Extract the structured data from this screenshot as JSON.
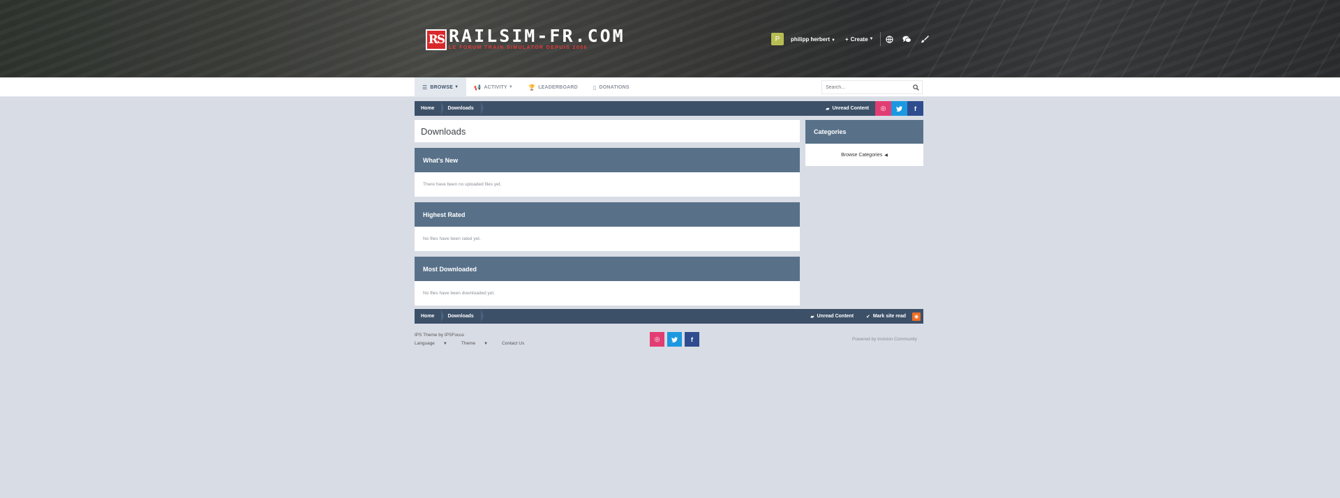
{
  "header": {
    "logo_badge": "RS",
    "logo_title": "RAILSIM-FR.COM",
    "logo_subtitle": "LE FORUM TRAIN SIMULATOR DEPUIS 2006",
    "avatar_letter": "P",
    "user_name": "philipp herbert",
    "create_label": "Create"
  },
  "nav": {
    "items": [
      {
        "label": "BROWSE",
        "icon": "list-icon",
        "active": true,
        "dropdown": true
      },
      {
        "label": "ACTIVITY",
        "icon": "megaphone-icon",
        "active": false,
        "dropdown": true
      },
      {
        "label": "LEADERBOARD",
        "icon": "trophy-icon",
        "active": false,
        "dropdown": false
      },
      {
        "label": "DONATIONS",
        "icon": "document-icon",
        "active": false,
        "dropdown": false
      }
    ],
    "search_placeholder": "Search..."
  },
  "breadcrumb": {
    "items": [
      "Home",
      "Downloads"
    ],
    "unread_label": "Unread Content",
    "mark_read_label": "Mark site read"
  },
  "main": {
    "page_title": "Downloads",
    "widgets": [
      {
        "title": "What's New",
        "message": "There have been no uploaded files yet."
      },
      {
        "title": "Highest Rated",
        "message": "No files have been rated yet."
      },
      {
        "title": "Most Downloaded",
        "message": "No files have been downloaded yet."
      }
    ]
  },
  "sidebar": {
    "title": "Categories",
    "link": "Browse Categories"
  },
  "footer": {
    "theme_credit": "IPS Theme by IPSFocus",
    "language_label": "Language",
    "theme_label": "Theme",
    "contact_label": "Contact Us",
    "powered_by": "Powered by Invision Community"
  },
  "colors": {
    "accent": "#3c5068",
    "widget_header": "#587189",
    "instagram": "#e23d73",
    "twitter": "#1b98e0",
    "facebook": "#2f4d8e",
    "rss": "#ee6e26"
  }
}
